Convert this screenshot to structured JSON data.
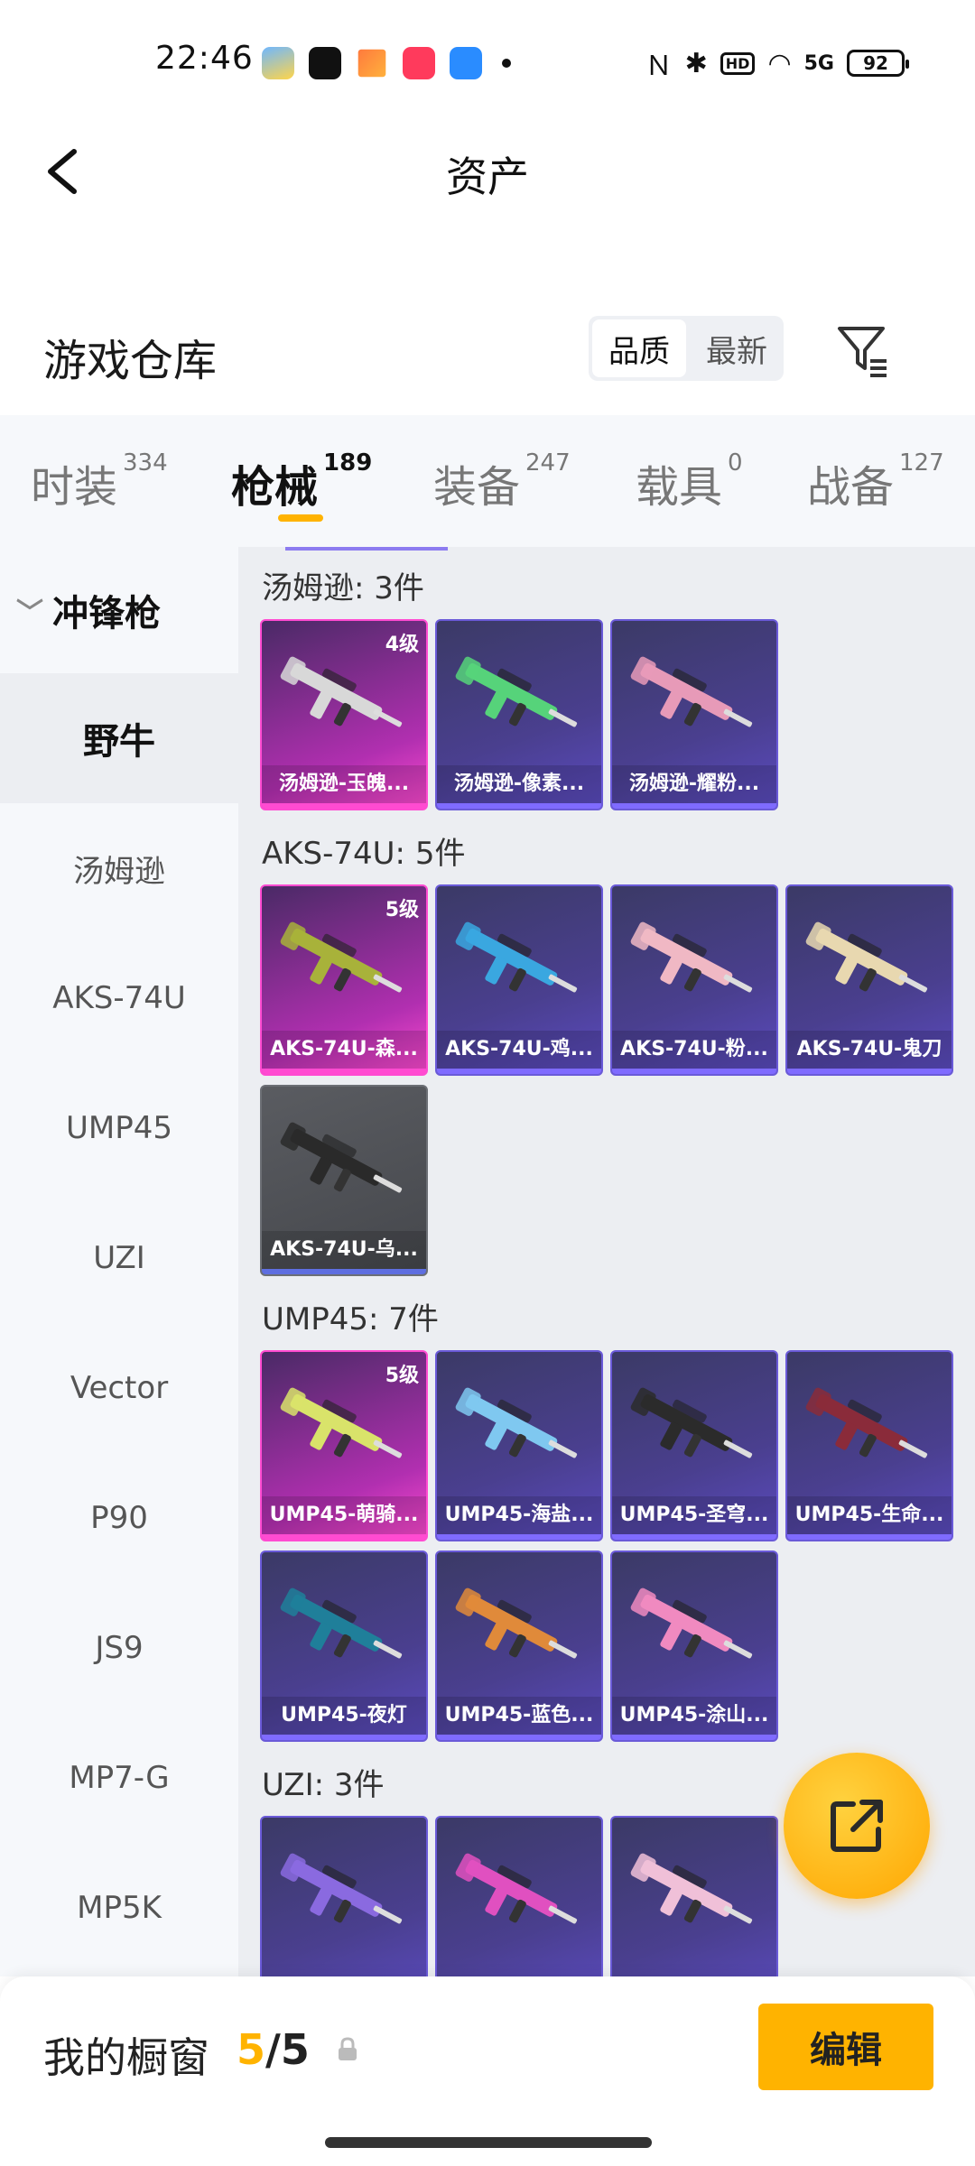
{
  "status_bar": {
    "time": "22:46",
    "battery": "92",
    "signal": "5G"
  },
  "header": {
    "title": "资产"
  },
  "warehouse": {
    "title": "游戏仓库",
    "sort_options": [
      "品质",
      "最新"
    ]
  },
  "tabs": [
    {
      "label": "时装",
      "count": "334"
    },
    {
      "label": "枪械",
      "count": "189"
    },
    {
      "label": "装备",
      "count": "247"
    },
    {
      "label": "载具",
      "count": "0"
    },
    {
      "label": "战备",
      "count": "127"
    }
  ],
  "sidebar": {
    "group": "冲锋枪",
    "items": [
      "野牛",
      "汤姆逊",
      "AKS-74U",
      "UMP45",
      "UZI",
      "Vector",
      "P90",
      "JS9",
      "MP7-G",
      "MP5K"
    ]
  },
  "sections": [
    {
      "title": "汤姆逊: 3件",
      "items": [
        {
          "name": "汤姆逊-玉魄...",
          "level": "4级",
          "rarity": "pink",
          "color": "#d8d8d8"
        },
        {
          "name": "汤姆逊-像素...",
          "level": "",
          "rarity": "purple",
          "color": "#56d37a"
        },
        {
          "name": "汤姆逊-耀粉...",
          "level": "",
          "rarity": "purple",
          "color": "#e79ab8"
        }
      ]
    },
    {
      "title": "AKS-74U: 5件",
      "items": [
        {
          "name": "AKS-74U-森...",
          "level": "5级",
          "rarity": "pink",
          "color": "#a8b23a"
        },
        {
          "name": "AKS-74U-鸡...",
          "level": "",
          "rarity": "purple",
          "color": "#3aa7e0"
        },
        {
          "name": "AKS-74U-粉...",
          "level": "",
          "rarity": "purple",
          "color": "#f0b8c4"
        },
        {
          "name": "AKS-74U-鬼刀",
          "level": "",
          "rarity": "purple",
          "color": "#e8d8b0"
        },
        {
          "name": "AKS-74U-乌...",
          "level": "",
          "rarity": "grey",
          "color": "#2a2a2a"
        }
      ]
    },
    {
      "title": "UMP45: 7件",
      "items": [
        {
          "name": "UMP45-萌骑...",
          "level": "5级",
          "rarity": "pink",
          "color": "#d9e36a"
        },
        {
          "name": "UMP45-海盐...",
          "level": "",
          "rarity": "purple",
          "color": "#7fc8f0"
        },
        {
          "name": "UMP45-圣穹...",
          "level": "",
          "rarity": "purple",
          "color": "#2b2b2b"
        },
        {
          "name": "UMP45-生命...",
          "level": "",
          "rarity": "purple",
          "color": "#8a2b3a"
        },
        {
          "name": "UMP45-夜灯",
          "level": "",
          "rarity": "purple",
          "color": "#1f7f9a"
        },
        {
          "name": "UMP45-蓝色...",
          "level": "",
          "rarity": "purple",
          "color": "#e08a3a"
        },
        {
          "name": "UMP45-涂山...",
          "level": "",
          "rarity": "purple",
          "color": "#f08ac0"
        }
      ]
    },
    {
      "title": "UZI: 3件",
      "items": [
        {
          "name": "",
          "level": "",
          "rarity": "purple",
          "color": "#8a6ae0"
        },
        {
          "name": "",
          "level": "",
          "rarity": "purple",
          "color": "#e050c0"
        },
        {
          "name": "",
          "level": "",
          "rarity": "purple",
          "color": "#f0c0d8"
        }
      ]
    }
  ],
  "showcase": {
    "label": "我的橱窗",
    "current": "5",
    "separator": "/",
    "total": "5",
    "edit_label": "编辑"
  },
  "colors": {
    "accent": "#ffb300",
    "epic": "#ff4bd1",
    "rare": "#6a5ad8"
  }
}
